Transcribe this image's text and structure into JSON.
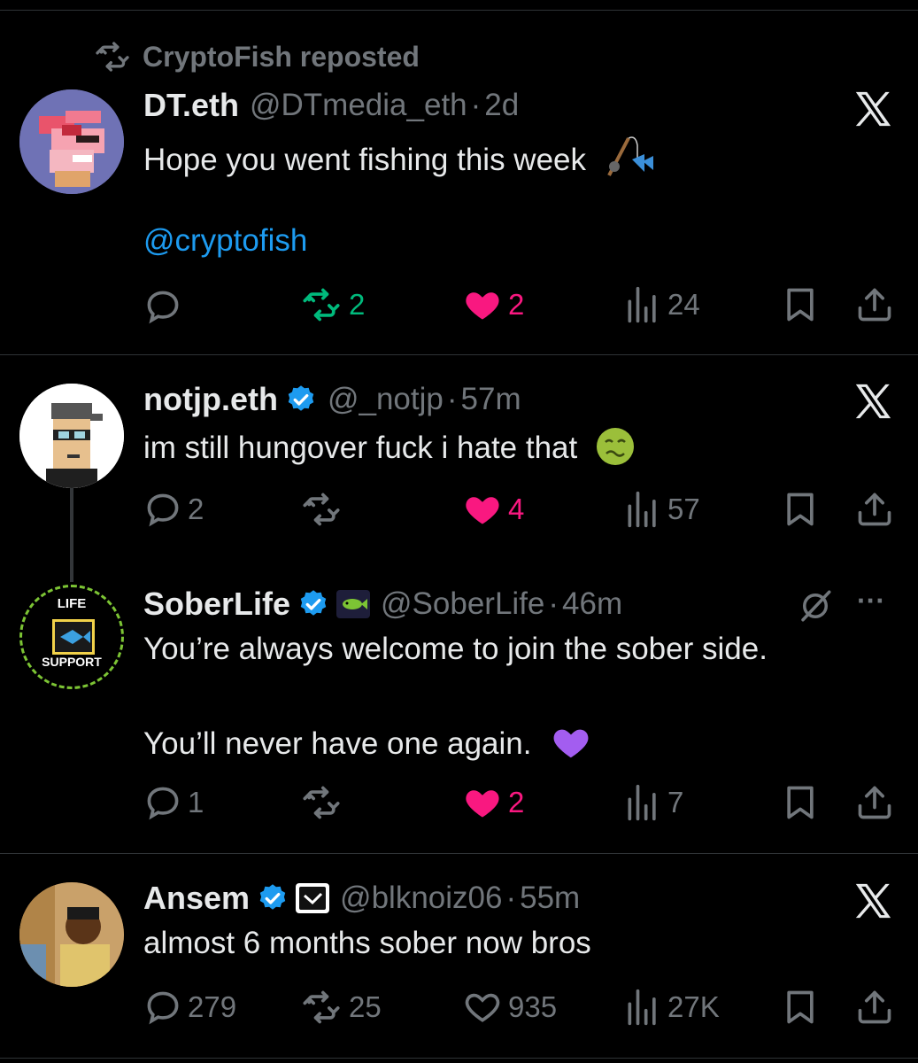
{
  "repost_banner": {
    "label": "CryptoFish reposted"
  },
  "posts": [
    {
      "name": "DT.eth",
      "handle": "@DTmedia_eth",
      "sep": "·",
      "time": "2d",
      "text_line1": "Hope you went fishing this week",
      "mention": "@cryptofish",
      "actions": {
        "replies": "",
        "reposts": "2",
        "likes": "2",
        "views": "24"
      }
    },
    {
      "name": "notjp.eth",
      "handle": "@_notjp",
      "sep": "·",
      "time": "57m",
      "text_line1": "im still hungover fuck i hate that",
      "actions": {
        "replies": "2",
        "reposts": "",
        "likes": "4",
        "views": "57"
      }
    },
    {
      "name": "SoberLife",
      "handle": "@SoberLife",
      "sep": "·",
      "time": "46m",
      "avatar_top_text": "LIFE",
      "avatar_bottom_text": "SUPPORT",
      "text_line1": "You’re always welcome to join the sober side.",
      "text_line2": "You’ll never have one again.",
      "more": "···",
      "actions": {
        "replies": "1",
        "reposts": "",
        "likes": "2",
        "views": "7"
      }
    },
    {
      "name": "Ansem",
      "handle": "@blknoiz06",
      "sep": "·",
      "time": "55m",
      "text_line1": "almost 6 months sober now bros",
      "actions": {
        "replies": "279",
        "reposts": "25",
        "likes": "935",
        "views": "27K"
      }
    }
  ],
  "colors": {
    "accent": "#1d9bf0",
    "repost_green": "#00ba7c",
    "like_pink": "#f91880",
    "muted": "#71767b"
  }
}
